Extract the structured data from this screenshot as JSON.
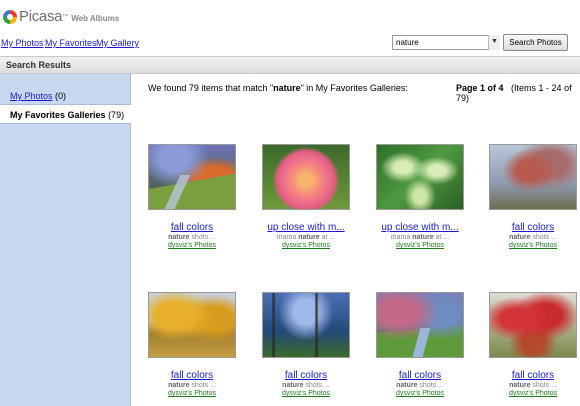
{
  "app": {
    "logo_text": "Picasa",
    "logo_tm": "™",
    "logo_sub": "Web Albums"
  },
  "nav": {
    "my_photos": "My Photos",
    "my_favorites": "My Favorites",
    "my_gallery": "My Gallery"
  },
  "search": {
    "value": "nature",
    "dropdown_glyph": "▼",
    "button_label": "Search Photos"
  },
  "results_bar": {
    "label": "Search Results"
  },
  "sidebar": {
    "photos_label": "My Photos",
    "photos_count": "(0)",
    "favorites_label": "My Favorites Galleries",
    "favorites_count": "(79)"
  },
  "summary": {
    "prefix": "We found 79 items that match \"",
    "term": "nature",
    "suffix": "\" in My Favorites Galleries:"
  },
  "pager": {
    "page": "Page 1 of 4",
    "range": "(Items 1 - 24 of 79)"
  },
  "results": [
    {
      "title": "fall colors",
      "desc_term": "nature",
      "desc_rest": "shots ...",
      "desc_prefix": "",
      "owner": "dysviz's Photos",
      "image": "fall-path-image"
    },
    {
      "title": "up close with m...",
      "desc_prefix": "mama",
      "desc_term": "nature",
      "desc_rest": "at ...",
      "owner": "dysviz's Photos",
      "image": "rose-image"
    },
    {
      "title": "up close with m...",
      "desc_prefix": "mama",
      "desc_term": "nature",
      "desc_rest": "at ...",
      "owner": "dysviz's Photos",
      "image": "hosta-image"
    },
    {
      "title": "fall colors",
      "desc_prefix": "",
      "desc_term": "nature",
      "desc_rest": "shots ...",
      "owner": "dysviz's Photos",
      "image": "tree-image"
    },
    {
      "title": "fall colors",
      "desc_prefix": "",
      "desc_term": "nature",
      "desc_rest": "shots ...",
      "owner": "dysviz's Photos",
      "image": "yellow-trees-image"
    },
    {
      "title": "fall colors",
      "desc_prefix": "",
      "desc_term": "nature",
      "desc_rest": "shots ...",
      "owner": "dysviz's Photos",
      "image": "blue-trees-image"
    },
    {
      "title": "fall colors",
      "desc_prefix": "",
      "desc_term": "nature",
      "desc_rest": "shots ...",
      "owner": "dysviz's Photos",
      "image": "garden-path-image"
    },
    {
      "title": "fall colors",
      "desc_prefix": "",
      "desc_term": "nature",
      "desc_rest": "shots ...",
      "owner": "dysviz's Photos",
      "image": "red-leaves-image"
    }
  ]
}
